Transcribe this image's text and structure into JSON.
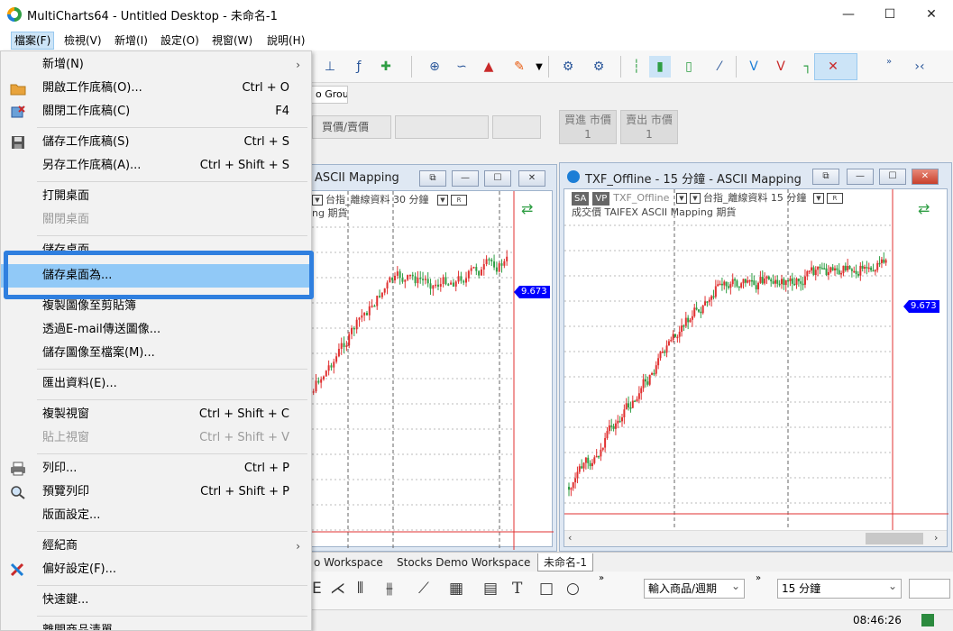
{
  "window": {
    "title": "MultiCharts64 - Untitled Desktop - 未命名-1",
    "minimize": "—",
    "maximize": "☐",
    "close": "✕"
  },
  "menubar": {
    "items": [
      {
        "label": "檔案(F)",
        "active": true
      },
      {
        "label": "檢視(V)"
      },
      {
        "label": "新增(I)"
      },
      {
        "label": "設定(O)"
      },
      {
        "label": "視窗(W)"
      },
      {
        "label": "說明(H)"
      }
    ]
  },
  "file_menu": {
    "items": [
      {
        "label": "新增(N)",
        "submenu": true
      },
      {
        "label": "開啟工作底稿(O)...",
        "shortcut": "Ctrl + O",
        "icon": "folder-icon"
      },
      {
        "label": "關閉工作底稿(C)",
        "shortcut": "F4",
        "icon": "close-workspace-icon"
      },
      {
        "label": "儲存工作底稿(S)",
        "shortcut": "Ctrl + S",
        "icon": "floppy-disk-icon"
      },
      {
        "label": "另存工作底稿(A)...",
        "shortcut": "Ctrl + Shift + S"
      },
      {
        "label": "打開桌面"
      },
      {
        "label": "關閉桌面",
        "disabled": true
      },
      {
        "label": "儲存桌面"
      },
      {
        "label": "儲存桌面為...",
        "highlighted": true
      },
      {
        "label": "複製圖像至剪貼簿"
      },
      {
        "label": "透過E-mail傳送圖像..."
      },
      {
        "label": "儲存圖像至檔案(M)..."
      },
      {
        "label": "匯出資料(E)..."
      },
      {
        "label": "複製視窗",
        "shortcut": "Ctrl + Shift + C"
      },
      {
        "label": "貼上視窗",
        "shortcut": "Ctrl + Shift + V",
        "disabled": true
      },
      {
        "label": "列印...",
        "shortcut": "Ctrl + P",
        "icon": "printer-icon"
      },
      {
        "label": "預覽列印",
        "shortcut": "Ctrl + Shift + P",
        "icon": "print-preview-icon"
      },
      {
        "label": "版面設定..."
      },
      {
        "label": "經紀商",
        "submenu": true
      },
      {
        "label": "偏好設定(F)...",
        "icon": "preferences-tools-icon"
      },
      {
        "label": "快速鍵..."
      },
      {
        "label": "離開商品清單"
      }
    ]
  },
  "toolbar": {
    "group_tab": "o Group",
    "trade": {
      "buy_sell": "買價/賣價",
      "buy_market": "買進 市價",
      "buy_qty": "1",
      "sell_market": "賣出 市價",
      "sell_qty": "1"
    }
  },
  "chart_left": {
    "title": "ASCII Mapping",
    "info_line1": "台指_離線資料  30 分鐘",
    "info_line2": "ng  期貨",
    "price_tag": "9.673"
  },
  "chart_right": {
    "title": "TXF_Offline - 15 分鐘 - ASCII Mapping",
    "badge_sa": "SA",
    "badge_vp": "VP",
    "symbol": "TXF_Offline",
    "info_line1": "台指_離線資料  15 分鐘",
    "info_line2": "成交價  TAIFEX  ASCII Mapping  期貨",
    "price_tag": "9.673"
  },
  "workspace_tabs": [
    {
      "label": "o Workspace"
    },
    {
      "label": "Stocks Demo Workspace"
    },
    {
      "label": "未命名-1",
      "active": true
    }
  ],
  "drawbar": {
    "symbol_input": "輸入商品/週期",
    "interval": "15 分鐘"
  },
  "status": {
    "time": "08:46:26"
  },
  "colors": {
    "highlight_frame": "#2f7fdf",
    "menu_highlight": "#91c9f7",
    "candle_up": "#e03131",
    "candle_down": "#2f9e44",
    "price_tag": "#0000ff"
  }
}
